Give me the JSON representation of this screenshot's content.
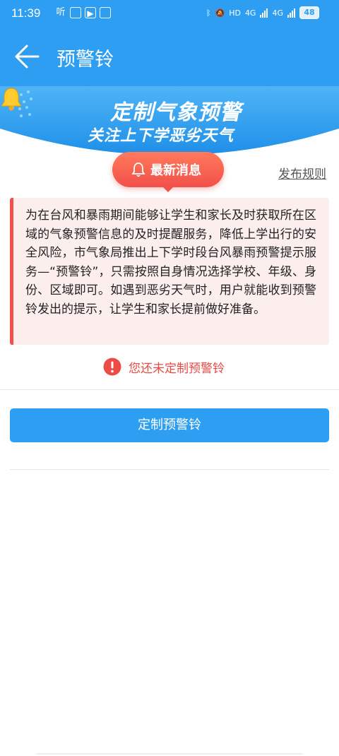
{
  "status_bar": {
    "time": "11:39",
    "left_icons": [
      "ting-app-icon",
      "app-icon",
      "media-app-icon",
      "app-badge-icon"
    ],
    "network_1": "4G",
    "network_2": "4G",
    "hd_label": "HD",
    "battery": "48"
  },
  "header": {
    "title": "预警铃"
  },
  "banner": {
    "title": "定制气象预警",
    "subtitle": "关注上下学恶劣天气"
  },
  "news": {
    "label": "最新消息"
  },
  "rules_link": "发布规则",
  "notice": {
    "text": "为在台风和暴雨期间能够让学生和家长及时获取所在区域的气象预警信息的及时提醒服务，降低上学出行的安全风险，市气象局推出上下学时段台风暴雨预警提示服务—“预警铃”，只需按照自身情况选择学校、年级、身份、区域即可。如遇到恶劣天气时，用户就能收到预警铃发出的提示，让学生和家长提前做好准备。"
  },
  "warning": {
    "text": "您还未定制预警铃"
  },
  "cta": {
    "label": "定制预警铃"
  },
  "colors": {
    "primary": "#2e9ef2",
    "accent_red": "#f2504a",
    "notice_bg": "#fdeeee"
  }
}
